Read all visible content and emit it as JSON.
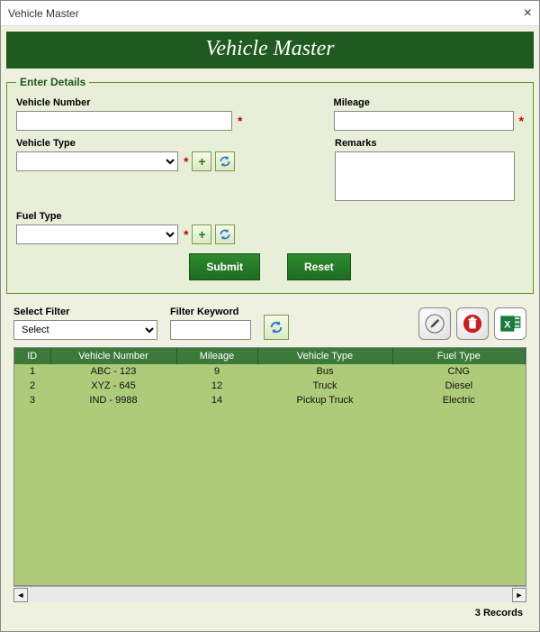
{
  "window": {
    "title": "Vehicle  Master"
  },
  "banner": {
    "title": "Vehicle  Master"
  },
  "form": {
    "legend": "Enter Details",
    "vehicle_number": {
      "label": "Vehicle Number",
      "value": ""
    },
    "vehicle_type": {
      "label": "Vehicle Type",
      "value": ""
    },
    "fuel_type": {
      "label": "Fuel Type",
      "value": ""
    },
    "mileage": {
      "label": "Mileage",
      "value": ""
    },
    "remarks": {
      "label": "Remarks",
      "value": ""
    },
    "submit_label": "Submit",
    "reset_label": "Reset"
  },
  "filter": {
    "select_label": "Select Filter",
    "select_value": "Select",
    "keyword_label": "Filter Keyword",
    "keyword_value": ""
  },
  "grid": {
    "columns": [
      "ID",
      "Vehicle Number",
      "Mileage",
      "Vehicle Type",
      "Fuel Type"
    ],
    "rows": [
      {
        "id": "1",
        "vehicle_number": "ABC - 123",
        "mileage": "9",
        "vehicle_type": "Bus",
        "fuel_type": "CNG"
      },
      {
        "id": "2",
        "vehicle_number": "XYZ - 645",
        "mileage": "12",
        "vehicle_type": "Truck",
        "fuel_type": "Diesel"
      },
      {
        "id": "3",
        "vehicle_number": "IND - 9988",
        "mileage": "14",
        "vehicle_type": "Pickup Truck",
        "fuel_type": "Electric"
      }
    ]
  },
  "footer": {
    "record_count": "3 Records"
  },
  "icons": {
    "add": "+",
    "refresh": "refresh-icon",
    "edit": "pencil-icon",
    "delete": "trash-icon",
    "export": "excel-icon",
    "close": "×"
  }
}
